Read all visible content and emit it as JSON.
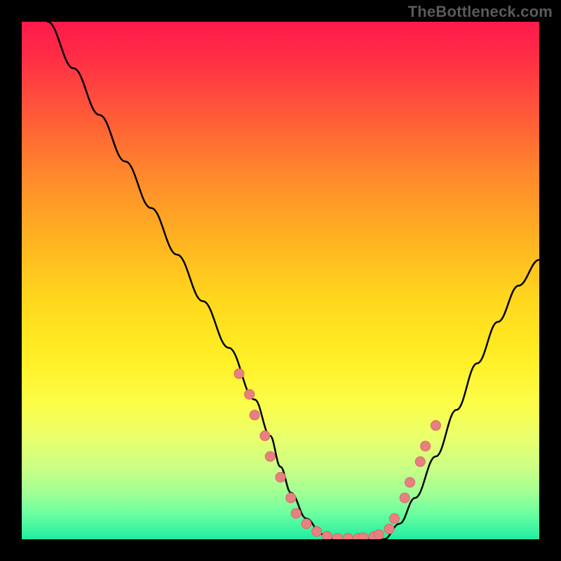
{
  "watermark": "TheBottleneck.com",
  "colors": {
    "background": "#000000",
    "curve_stroke": "#000000",
    "marker_fill": "#e98080",
    "marker_stroke": "#d46a6a"
  },
  "chart_data": {
    "type": "line",
    "title": "",
    "xlabel": "",
    "ylabel": "",
    "xlim": [
      0,
      100
    ],
    "ylim": [
      0,
      100
    ],
    "grid": false,
    "legend": false,
    "series": [
      {
        "name": "left-curve",
        "x": [
          5,
          10,
          15,
          20,
          25,
          30,
          35,
          40,
          45,
          48,
          50,
          52,
          55,
          58,
          60
        ],
        "y": [
          100,
          91,
          82,
          73,
          64,
          55,
          46,
          37,
          27,
          20,
          14,
          9,
          4,
          1,
          0
        ]
      },
      {
        "name": "valley-floor",
        "x": [
          60,
          62,
          64,
          66,
          68,
          70
        ],
        "y": [
          0,
          0,
          0,
          0,
          0,
          0
        ]
      },
      {
        "name": "right-curve",
        "x": [
          70,
          73,
          76,
          80,
          84,
          88,
          92,
          96,
          100
        ],
        "y": [
          0,
          3,
          8,
          16,
          25,
          34,
          42,
          49,
          54
        ]
      }
    ],
    "markers": {
      "name": "highlight-points",
      "points": [
        {
          "x": 42,
          "y": 32
        },
        {
          "x": 44,
          "y": 28
        },
        {
          "x": 45,
          "y": 24
        },
        {
          "x": 47,
          "y": 20
        },
        {
          "x": 48,
          "y": 16
        },
        {
          "x": 50,
          "y": 12
        },
        {
          "x": 52,
          "y": 8
        },
        {
          "x": 53,
          "y": 5
        },
        {
          "x": 55,
          "y": 3
        },
        {
          "x": 57,
          "y": 1.5
        },
        {
          "x": 59,
          "y": 0.6
        },
        {
          "x": 61,
          "y": 0.2
        },
        {
          "x": 63,
          "y": 0.2
        },
        {
          "x": 65,
          "y": 0.2
        },
        {
          "x": 66,
          "y": 0.3
        },
        {
          "x": 68,
          "y": 0.5
        },
        {
          "x": 69,
          "y": 0.9
        },
        {
          "x": 71,
          "y": 2
        },
        {
          "x": 72,
          "y": 4
        },
        {
          "x": 74,
          "y": 8
        },
        {
          "x": 75,
          "y": 11
        },
        {
          "x": 77,
          "y": 15
        },
        {
          "x": 78,
          "y": 18
        },
        {
          "x": 80,
          "y": 22
        }
      ]
    }
  }
}
